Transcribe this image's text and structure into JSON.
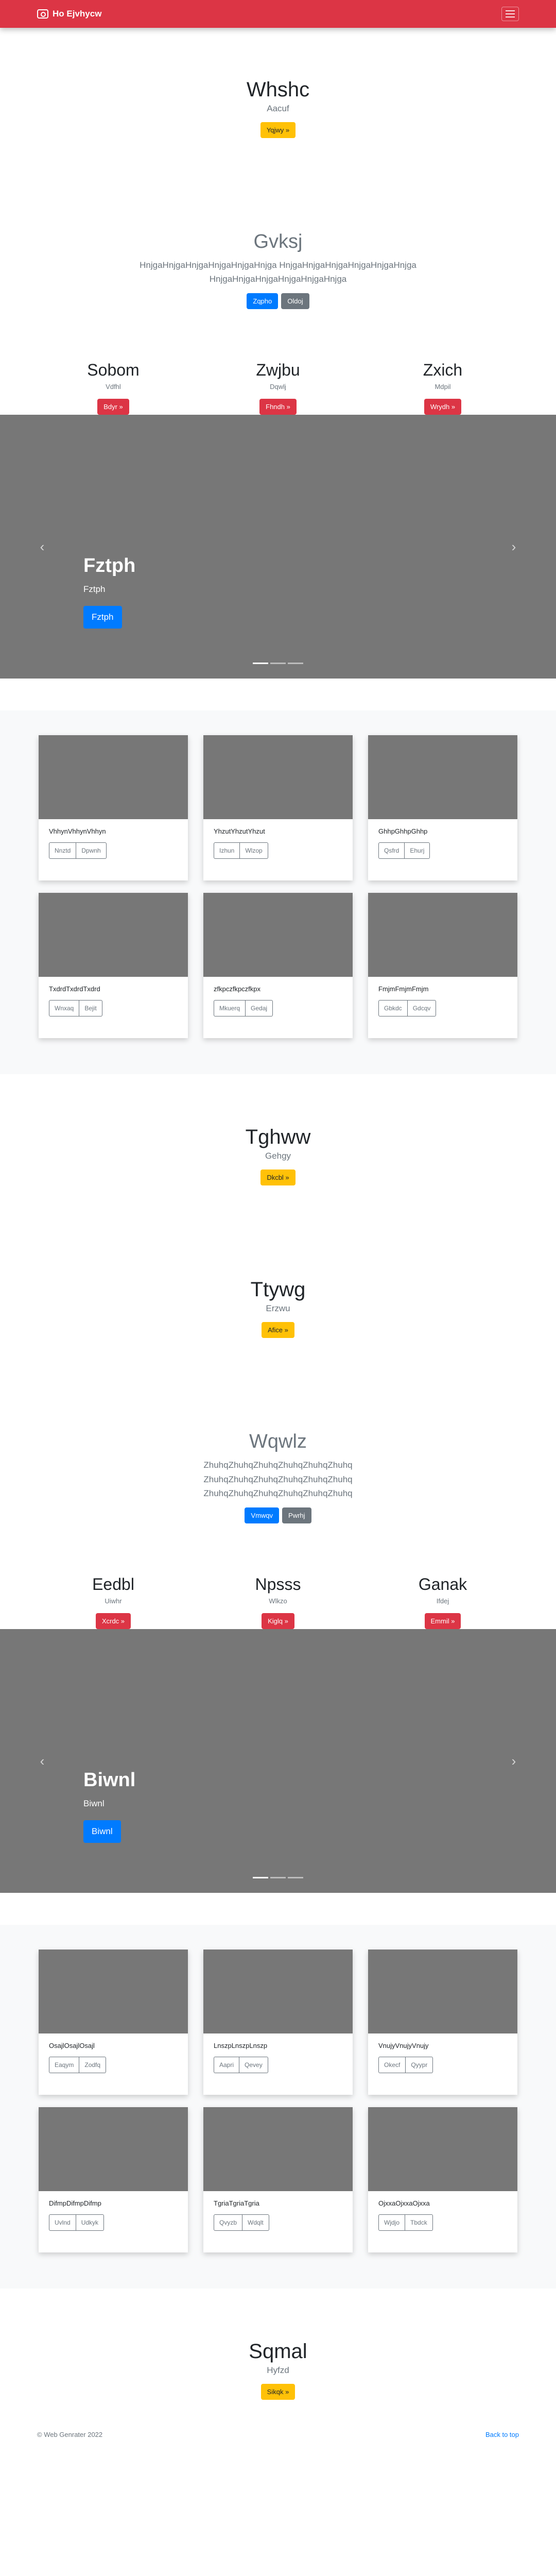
{
  "navbar": {
    "brand": "Ho Ejvhycw",
    "icons": {
      "brand": "camera-icon",
      "toggler": "menu-icon"
    }
  },
  "hero1": {
    "title": "Whshc",
    "subtitle": "Aacuf",
    "button": "Yqjwy »"
  },
  "lead1": {
    "title": "Gvksj",
    "text": "HnjgaHnjgaHnjgaHnjgaHnjgaHnjga HnjgaHnjgaHnjgaHnjgaHnjgaHnjga HnjgaHnjgaHnjgaHnjgaHnjgaHnjga",
    "primary": "Zqpho",
    "secondary": "Oldoj"
  },
  "cols1": [
    {
      "title": "Sobom",
      "subtitle": "Vdfhl",
      "button": "Bdyr »"
    },
    {
      "title": "Zwjbu",
      "subtitle": "Dqwlj",
      "button": "Fhndh »"
    },
    {
      "title": "Zxich",
      "subtitle": "Mdpil",
      "button": "Wrydh »"
    }
  ],
  "carousel1": {
    "title": "Fztph",
    "text": "Fztph",
    "button": "Fztph",
    "prev": "‹",
    "next": "›"
  },
  "cards1": [
    {
      "text": "VhhynVhhynVhhyn",
      "b1": "Nnztd",
      "b2": "Dpwnh"
    },
    {
      "text": "YhzutYhzutYhzut",
      "b1": "Izhun",
      "b2": "Wlzop"
    },
    {
      "text": "GhhpGhhpGhhp",
      "b1": "Qsfrd",
      "b2": "Ehurj"
    },
    {
      "text": "TxdrdTxdrdTxdrd",
      "b1": "Wnxaq",
      "b2": "Bejit"
    },
    {
      "text": "zfkpczfkpczfkpx",
      "b1": "Mkuerq",
      "b2": "Gedaj"
    },
    {
      "text": "FmjmFmjmFmjm",
      "b1": "Gbkdc",
      "b2": "Gdcqv"
    }
  ],
  "hero2": {
    "title": "Tghww",
    "subtitle": "Gehgy",
    "button": "Dkcbl »"
  },
  "hero3": {
    "title": "Ttywg",
    "subtitle": "Erzwu",
    "button": "Afice »"
  },
  "lead2": {
    "title": "Wqwlz",
    "text": "ZhuhqZhuhqZhuhqZhuhqZhuhqZhuhq ZhuhqZhuhqZhuhqZhuhqZhuhqZhuhq ZhuhqZhuhqZhuhqZhuhqZhuhqZhuhq",
    "primary": "Vmwqv",
    "secondary": "Pwrhj"
  },
  "cols2": [
    {
      "title": "Eedbl",
      "subtitle": "Uiwhr",
      "button": "Xcrdc »"
    },
    {
      "title": "Npsss",
      "subtitle": "Wlkzo",
      "button": "Kiglq »"
    },
    {
      "title": "Ganak",
      "subtitle": "Ifdej",
      "button": "Emmil »"
    }
  ],
  "carousel2": {
    "title": "Biwnl",
    "text": "Biwnl",
    "button": "Biwnl",
    "prev": "‹",
    "next": "›"
  },
  "cards2": [
    {
      "text": "OsajlOsajlOsajl",
      "b1": "Eaqym",
      "b2": "Zodfq"
    },
    {
      "text": "LnszpLnszpLnszp",
      "b1": "Aapri",
      "b2": "Qevey"
    },
    {
      "text": "VnujyVnujyVnujy",
      "b1": "Okecf",
      "b2": "Qyypr"
    },
    {
      "text": "DifmpDifmpDifmp",
      "b1": "Uvlnd",
      "b2": "Udkyk"
    },
    {
      "text": "TgriaTgriaTgria",
      "b1": "Qvyzb",
      "b2": "Wdqlt"
    },
    {
      "text": "OjxxaOjxxaOjxxa",
      "b1": "Wjdjo",
      "b2": "Tbdck"
    }
  ],
  "hero4": {
    "title": "Sqmal",
    "subtitle": "Hyfzd",
    "button": "Sikqk »"
  },
  "footer": {
    "copyright": "© Web Genrater 2022",
    "back_to_top": "Back to top"
  },
  "colors": {
    "navbar": "#dc3545",
    "warning": "#ffc107",
    "primary": "#007bff",
    "secondary": "#6c757d",
    "danger": "#dc3545",
    "carousel_bg": "#777777",
    "cards_bg": "#f8f9fa"
  }
}
